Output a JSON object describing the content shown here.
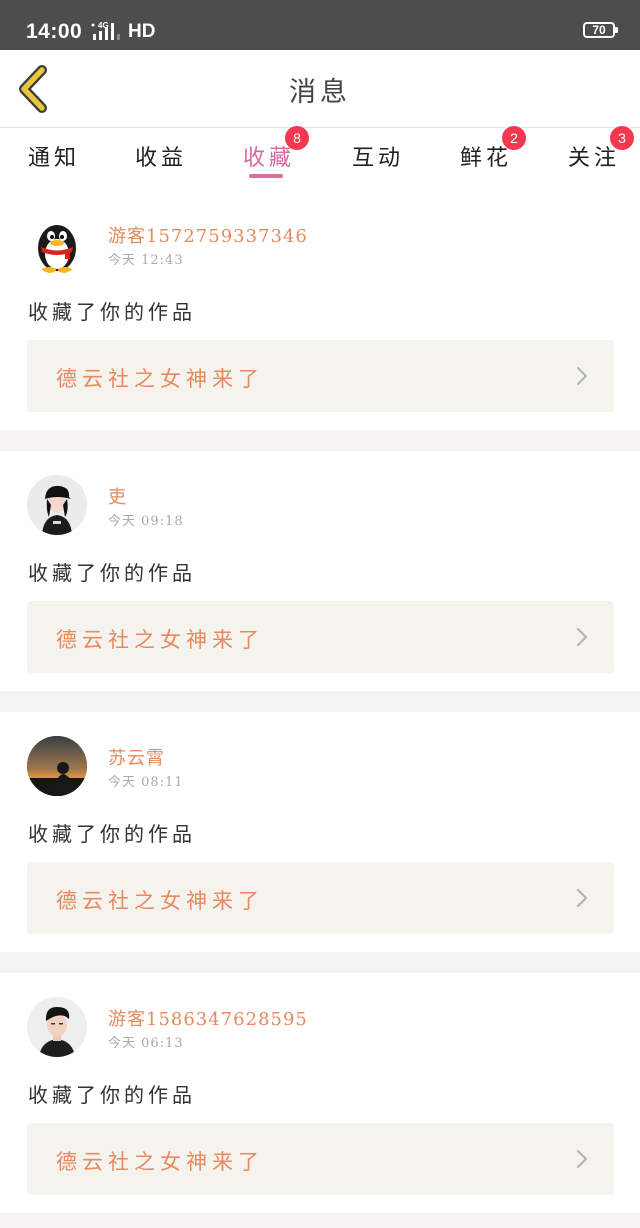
{
  "status_bar": {
    "time": "14:00",
    "network": "HD",
    "signal_label": "4G",
    "battery": "70"
  },
  "header": {
    "title": "消息",
    "back_icon": "chevron-left-icon"
  },
  "tabs": [
    {
      "label": "通知",
      "badge": null,
      "active": false
    },
    {
      "label": "收益",
      "badge": null,
      "active": false
    },
    {
      "label": "收藏",
      "badge": "8",
      "active": true
    },
    {
      "label": "互动",
      "badge": null,
      "active": false
    },
    {
      "label": "鲜花",
      "badge": "2",
      "active": false
    },
    {
      "label": "关注",
      "badge": "3",
      "active": false
    }
  ],
  "messages": [
    {
      "user": "游客1572759337346",
      "time": "今天 12:43",
      "avatar_icon": "penguin-avatar",
      "text": "收藏了你的作品",
      "work_title": "德云社之女神来了"
    },
    {
      "user": "吏",
      "time": "今天 09:18",
      "avatar_icon": "girl-avatar",
      "text": "收藏了你的作品",
      "work_title": "德云社之女神来了"
    },
    {
      "user": "苏云霄",
      "time": "今天 08:11",
      "avatar_icon": "sunset-avatar",
      "text": "收藏了你的作品",
      "work_title": "德云社之女神来了"
    },
    {
      "user": "游客1586347628595",
      "time": "今天 06:13",
      "avatar_icon": "man-avatar",
      "text": "收藏了你的作品",
      "work_title": "德云社之女神来了"
    }
  ],
  "colors": {
    "accent_pink": "#d66aa2",
    "badge_red": "#f3384f",
    "name_orange": "#e58a5c",
    "back_yellow": "#e6c73c"
  }
}
